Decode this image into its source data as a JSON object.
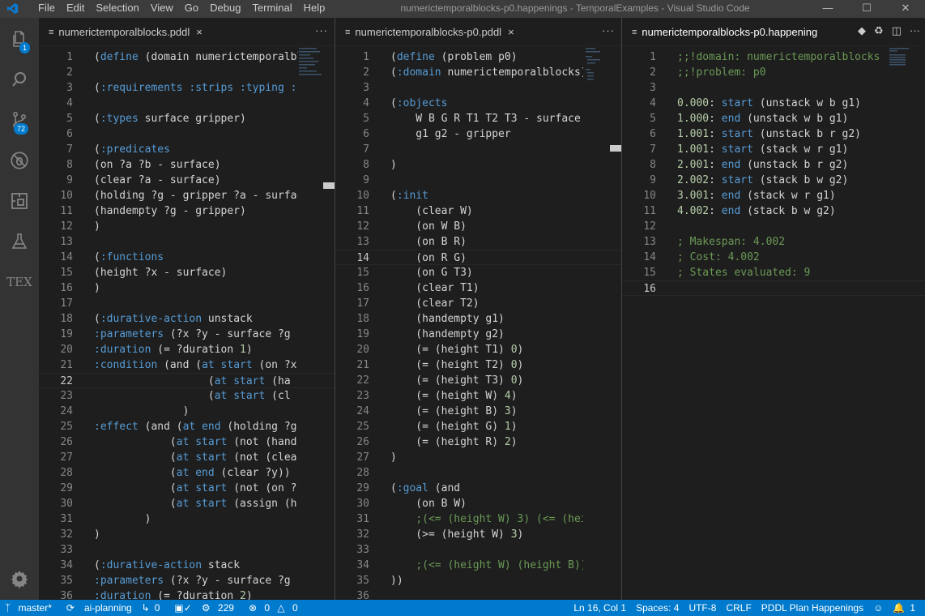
{
  "titlebar": {
    "title": "numerictemporalblocks-p0.happenings - TemporalExamples - Visual Studio Code",
    "menu": [
      "File",
      "Edit",
      "Selection",
      "View",
      "Go",
      "Debug",
      "Terminal",
      "Help"
    ]
  },
  "activity": {
    "explorer_badge": "1",
    "scm_badge": "72",
    "tex_label": "TEX"
  },
  "pane1": {
    "tab": "numerictemporalblocks.pddl",
    "current_line": 22,
    "lines": [
      "(define (domain numerictemporalbl",
      "",
      "(:requirements :strips :typing :f",
      "",
      "(:types surface gripper)",
      "",
      "(:predicates",
      "(on ?a ?b - surface)",
      "(clear ?a - surface)",
      "(holding ?g - gripper ?a - surfac",
      "(handempty ?g - gripper)",
      ")",
      "",
      "(:functions",
      "(height ?x - surface)",
      ")",
      "",
      "(:durative-action unstack",
      ":parameters (?x ?y - surface ?g -",
      ":duration (= ?duration 1)",
      ":condition (and (at start (on ?x",
      "                  (at start (ha",
      "                  (at start (cl",
      "              )",
      ":effect (and (at end (holding ?g",
      "            (at start (not (hand",
      "            (at start (not (clea",
      "            (at end (clear ?y))",
      "            (at start (not (on ?",
      "            (at start (assign (h",
      "        )",
      ")",
      "",
      "(:durative-action stack",
      ":parameters (?x ?y - surface ?g -",
      ":duration (= ?duration 2)"
    ]
  },
  "pane2": {
    "tab": "numerictemporalblocks-p0.pddl",
    "current_line": 14,
    "lines": [
      "(define (problem p0)",
      "(:domain numerictemporalblocks)",
      "",
      "(:objects",
      "    W B G R T1 T2 T3 - surface",
      "    g1 g2 - gripper",
      "",
      ")",
      "",
      "(:init",
      "    (clear W)",
      "    (on W B)",
      "    (on B R)",
      "    (on R G)",
      "    (on G T3)",
      "    (clear T1)",
      "    (clear T2)",
      "    (handempty g1)",
      "    (handempty g2)",
      "    (= (height T1) 0)",
      "    (= (height T2) 0)",
      "    (= (height T3) 0)",
      "    (= (height W) 4)",
      "    (= (height B) 3)",
      "    (= (height G) 1)",
      "    (= (height R) 2)",
      ")",
      "",
      "(:goal (and",
      "    (on B W)",
      "    ;(<= (height W) 3) (<= (hei",
      "    (>= (height W) 3)",
      "",
      "    ;(<= (height W) (height B))",
      "))",
      ""
    ]
  },
  "pane3": {
    "tab": "numerictemporalblocks-p0.happening",
    "current_line": 16,
    "lines": [
      ";;!domain: numerictemporalblocks",
      ";;!problem: p0",
      "",
      "0.000: start (unstack w b g1)",
      "1.000: end (unstack w b g1)",
      "1.001: start (unstack b r g2)",
      "1.001: start (stack w r g1)",
      "2.001: end (unstack b r g2)",
      "2.002: start (stack b w g2)",
      "3.001: end (stack w r g1)",
      "4.002: end (stack b w g2)",
      "",
      "; Makespan: 4.002",
      "; Cost: 4.002",
      "; States evaluated: 9",
      ""
    ]
  },
  "statusbar": {
    "branch": "master*",
    "sync": "ai-planning",
    "prs": "0",
    "tests": "229",
    "errors": "0",
    "warnings": "0",
    "position": "Ln 16, Col 1",
    "spaces": "Spaces: 4",
    "encoding": "UTF-8",
    "eol": "CRLF",
    "language": "PDDL Plan Happenings",
    "notifications": "1"
  }
}
